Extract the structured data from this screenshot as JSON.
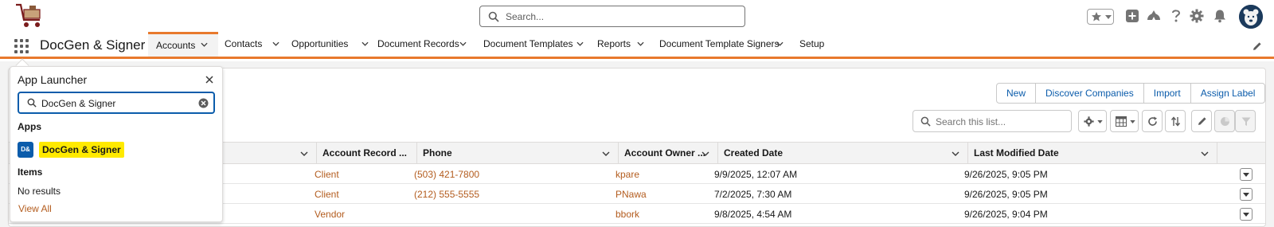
{
  "global_header": {
    "search_placeholder": "Search...",
    "icons": [
      "logo-icon",
      "favorites-star-icon",
      "add-icon",
      "trailhead-icon",
      "help-icon",
      "setup-gear-icon",
      "notifications-bell-icon",
      "avatar"
    ]
  },
  "app": {
    "name": "DocGen & Signer",
    "nav": [
      {
        "label": "Accounts",
        "active": true
      },
      {
        "label": "Contacts"
      },
      {
        "label": "Opportunities"
      },
      {
        "label": "Document Records"
      },
      {
        "label": "Document Templates"
      },
      {
        "label": "Reports"
      },
      {
        "label": "Document Template Signers"
      },
      {
        "label": "Setup"
      }
    ]
  },
  "list_view": {
    "buttons": [
      "New",
      "Discover Companies",
      "Import",
      "Assign Label"
    ],
    "search_placeholder": "Search this list...",
    "columns": [
      "Account Record ...",
      "Phone",
      "Account Owner ...",
      "Created Date",
      "Last Modified Date"
    ],
    "rows": [
      {
        "record_type": "Client",
        "phone": "(503) 421-7800",
        "owner": "kpare",
        "created": "9/9/2025, 12:07 AM",
        "modified": "9/26/2025, 9:05 PM"
      },
      {
        "record_type": "Client",
        "phone": "(212) 555-5555",
        "owner": "PNawa",
        "created": "7/2/2025, 7:30 AM",
        "modified": "9/26/2025, 9:05 PM"
      },
      {
        "record_type": "Vendor",
        "phone": "",
        "owner": "bbork",
        "created": "9/8/2025, 4:54 AM",
        "modified": "9/26/2025, 9:04 PM"
      }
    ]
  },
  "app_launcher": {
    "title": "App Launcher",
    "search_value": "DocGen & Signer",
    "apps_heading": "Apps",
    "app_badge": "D&",
    "app_result": "DocGen & Signer",
    "items_heading": "Items",
    "no_results": "No results",
    "view_all": "View All"
  },
  "colors": {
    "accent": "#e8792d",
    "link": "#b35c1e",
    "brand_blue": "#0b5cab",
    "highlight": "#ffea00"
  }
}
